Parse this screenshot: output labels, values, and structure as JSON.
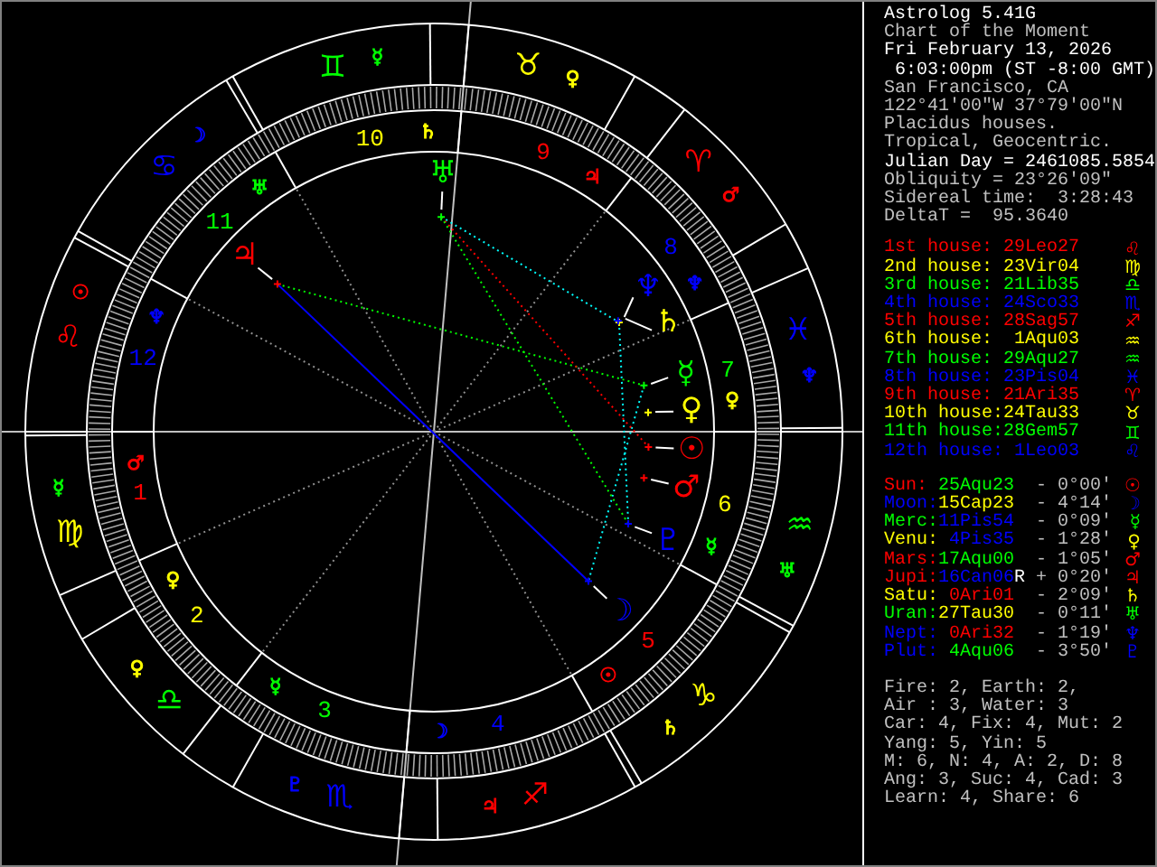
{
  "header": [
    {
      "text": "Astrolog 5.41G",
      "bright": true
    },
    {
      "text": "Chart of the Moment",
      "bright": false
    },
    {
      "text": "Fri February 13, 2026",
      "bright": true
    },
    {
      "text": " 6:03:00pm (ST -8:00 GMT)",
      "bright": true
    },
    {
      "text": "San Francisco, CA",
      "bright": false
    },
    {
      "text": "122°41'00\"W 37°79'00\"N",
      "bright": false
    },
    {
      "text": "Placidus houses.",
      "bright": false
    },
    {
      "text": "Tropical, Geocentric.",
      "bright": false
    },
    {
      "text": "Julian Day = 2461085.5854",
      "bright": true
    },
    {
      "text": "Obliquity = 23°26'09\"",
      "bright": false
    },
    {
      "text": "Sidereal time:  3:28:43",
      "bright": false
    },
    {
      "text": "DeltaT =  95.3640",
      "bright": false
    }
  ],
  "houses": [
    {
      "label": "1st house:",
      "position": "29Leo27",
      "glyph": "♌",
      "color": "#ff0000",
      "number": "1",
      "ruler": {
        "glyph": "♂",
        "color": "#ff0000"
      }
    },
    {
      "label": "2nd house:",
      "position": "23Vir04",
      "glyph": "♍",
      "color": "#ffff00",
      "number": "2",
      "ruler": {
        "glyph": "♀",
        "color": "#ffff00"
      }
    },
    {
      "label": "3rd house:",
      "position": "21Lib35",
      "glyph": "♎",
      "color": "#00ff00",
      "number": "3",
      "ruler": {
        "glyph": "☿",
        "color": "#00ff00"
      }
    },
    {
      "label": "4th house:",
      "position": "24Sco33",
      "glyph": "♏",
      "color": "#0000ff",
      "number": "4",
      "ruler": {
        "glyph": "☽",
        "color": "#0000ff"
      }
    },
    {
      "label": "5th house:",
      "position": "28Sag57",
      "glyph": "♐",
      "color": "#ff0000",
      "number": "5",
      "ruler": {
        "glyph": "☉",
        "color": "#ff0000"
      }
    },
    {
      "label": "6th house:",
      "position": "1Aqu03",
      "glyph": "♒",
      "color": "#ffff00",
      "number": "6",
      "ruler": {
        "glyph": "☿",
        "color": "#00ff00"
      }
    },
    {
      "label": "7th house:",
      "position": "29Aqu27",
      "glyph": "♒",
      "color": "#00ff00",
      "number": "7",
      "ruler": {
        "glyph": "♀",
        "color": "#ffff00"
      }
    },
    {
      "label": "8th house:",
      "position": "23Pis04",
      "glyph": "♓",
      "color": "#0000ff",
      "number": "8",
      "ruler": {
        "glyph": "♆",
        "color": "#0000ff"
      }
    },
    {
      "label": "9th house:",
      "position": "21Ari35",
      "glyph": "♈",
      "color": "#ff0000",
      "number": "9",
      "ruler": {
        "glyph": "♃",
        "color": "#ff0000"
      }
    },
    {
      "label": "10th house:",
      "position": "24Tau33",
      "glyph": "♉",
      "color": "#ffff00",
      "number": "10",
      "ruler": {
        "glyph": "♄",
        "color": "#ffff00"
      }
    },
    {
      "label": "11th house:",
      "position": "28Gem57",
      "glyph": "♊",
      "color": "#00ff00",
      "number": "11",
      "ruler": {
        "glyph": "♅",
        "color": "#00ff00"
      }
    },
    {
      "label": "12th house:",
      "position": "1Leo03",
      "glyph": "♌",
      "color": "#0000ff",
      "number": "12",
      "ruler": {
        "glyph": "♆",
        "color": "#0000ff"
      }
    }
  ],
  "planets": [
    {
      "name": "Sun:",
      "position": {
        "text": "25Aqu23",
        "color": "#00ff00"
      },
      "latitude": "- 0°00'",
      "glyph": "☉",
      "wheel_glyph": "☉",
      "color": "#ff0000"
    },
    {
      "name": "Moon:",
      "position": {
        "text": "15Cap23",
        "color": "#ffff00"
      },
      "latitude": "- 4°14'",
      "glyph": "☽",
      "wheel_glyph": "☽",
      "color": "#0000ff"
    },
    {
      "name": "Merc:",
      "position": {
        "text": "11Pis54",
        "color": "#0000ff"
      },
      "latitude": "- 0°09'",
      "glyph": "☿",
      "wheel_glyph": "☿",
      "color": "#00ff00"
    },
    {
      "name": "Venu:",
      "position": {
        "text": "4Pis35",
        "color": "#0000ff"
      },
      "latitude": "- 1°28'",
      "glyph": "♀",
      "wheel_glyph": "♀",
      "color": "#ffff00"
    },
    {
      "name": "Mars:",
      "position": {
        "text": "17Aqu00",
        "color": "#00ff00"
      },
      "latitude": "- 1°05'",
      "glyph": "♂",
      "wheel_glyph": "♂",
      "color": "#ff0000"
    },
    {
      "name": "Jupi:",
      "position": {
        "text": "16Can06",
        "color": "#0000ff"
      },
      "motion": "R",
      "latitude": "+ 0°20'",
      "glyph": "♃",
      "wheel_glyph": "♃",
      "color": "#ff0000"
    },
    {
      "name": "Satu:",
      "position": {
        "text": "0Ari01",
        "color": "#ff0000"
      },
      "latitude": "- 2°09'",
      "glyph": "♄",
      "wheel_glyph": "♄",
      "color": "#ffff00"
    },
    {
      "name": "Uran:",
      "position": {
        "text": "27Tau30",
        "color": "#ffff00"
      },
      "latitude": "- 0°11'",
      "glyph": "♅",
      "wheel_glyph": "♅",
      "color": "#00ff00"
    },
    {
      "name": "Nept:",
      "position": {
        "text": "0Ari32",
        "color": "#ff0000"
      },
      "latitude": "- 1°19'",
      "glyph": "♆",
      "wheel_glyph": "♆",
      "color": "#0000ff"
    },
    {
      "name": "Plut:",
      "position": {
        "text": "4Aqu06",
        "color": "#00ff00"
      },
      "latitude": "- 3°50'",
      "glyph": "♇",
      "wheel_glyph": "♇",
      "color": "#0000ff"
    }
  ],
  "signs": [
    {
      "glyph": "♈",
      "color": "#ff0000",
      "ruler": {
        "glyph": "♂",
        "color": "#ff0000"
      }
    },
    {
      "glyph": "♉",
      "color": "#ffff00",
      "ruler": {
        "glyph": "♀",
        "color": "#ffff00"
      }
    },
    {
      "glyph": "♊",
      "color": "#00ff00",
      "ruler": {
        "glyph": "☿",
        "color": "#00ff00"
      }
    },
    {
      "glyph": "♋",
      "color": "#0000ff",
      "ruler": {
        "glyph": "☽",
        "color": "#0000ff"
      }
    },
    {
      "glyph": "♌",
      "color": "#ff0000",
      "ruler": {
        "glyph": "☉",
        "color": "#ff0000"
      }
    },
    {
      "glyph": "♍",
      "color": "#ffff00",
      "ruler": {
        "glyph": "☿",
        "color": "#00ff00"
      }
    },
    {
      "glyph": "♎",
      "color": "#00ff00",
      "ruler": {
        "glyph": "♀",
        "color": "#ffff00"
      }
    },
    {
      "glyph": "♏",
      "color": "#0000ff",
      "ruler": {
        "glyph": "♇",
        "color": "#0000ff"
      }
    },
    {
      "glyph": "♐",
      "color": "#ff0000",
      "ruler": {
        "glyph": "♃",
        "color": "#ff0000"
      }
    },
    {
      "glyph": "♑",
      "color": "#ffff00",
      "ruler": {
        "glyph": "♄",
        "color": "#ffff00"
      }
    },
    {
      "glyph": "♒",
      "color": "#00ff00",
      "ruler": {
        "glyph": "♅",
        "color": "#00ff00"
      }
    },
    {
      "glyph": "♓",
      "color": "#0000ff",
      "ruler": {
        "glyph": "♆",
        "color": "#0000ff"
      }
    }
  ],
  "summary": [
    "Fire: 2, Earth: 2,",
    "Air : 3, Water: 3",
    "Car: 4, Fix: 4, Mut: 2",
    "Yang: 5, Yin: 5",
    "M: 6, N: 4, A: 2, D: 8",
    "Ang: 3, Suc: 4, Cad: 3",
    "Learn: 4, Share: 6"
  ]
}
